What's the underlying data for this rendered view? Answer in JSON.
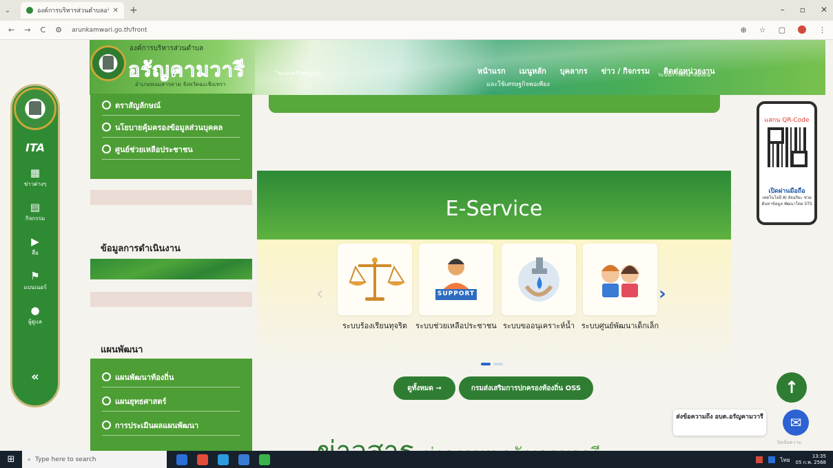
{
  "browser": {
    "tab_title": "องค์การบริหารส่วนตำบลอรัญ...",
    "url": "arunkamwari.go.th/front",
    "new_tab": "+",
    "controls": {
      "back": "←",
      "forward": "→",
      "reload": "C"
    },
    "window_controls": {
      "minimize": "–",
      "maximize": "▫",
      "close": "✕"
    }
  },
  "header": {
    "org_label": "องค์การบริหารส่วนตำบล",
    "site_name": "อรัญคามวารี",
    "tagline": "อำเภอพนมสารคาม จังหวัดฉะเชิงเทรา",
    "marquee": "\"ครอบครัวสมบูรณ์...",
    "nav": [
      "หน้าแรก",
      "เมนูหลัก",
      "บุคลากร",
      "ข่าว / กิจกรรม",
      "ติดต่อหน่วยงาน"
    ],
    "nav_sub": "และใช้เศรษฐกิจพอเพียง",
    "overlap_label": "ระบบการศึกษาท้องถิ่น"
  },
  "sidebar": {
    "ita": "ITA",
    "items": [
      {
        "label": "ข่าวต่างๆ",
        "icon": "news-icon",
        "glyph": "▦"
      },
      {
        "label": "กิจกรรม",
        "icon": "calendar-icon",
        "glyph": "▤"
      },
      {
        "label": "สื่อ",
        "icon": "play-icon",
        "glyph": "▶"
      },
      {
        "label": "แบนเนอร์",
        "icon": "flag-icon",
        "glyph": "⚑"
      },
      {
        "label": "ผู้ดูแล",
        "icon": "user-icon",
        "glyph": "●"
      }
    ],
    "collapse": "«"
  },
  "left_menu": {
    "items": [
      "ตราสัญลักษณ์",
      "นโยบายคุ้มครองข้อมูลส่วนบุคคล",
      "ศูนย์ช่วยเหลือประชาชน"
    ],
    "operations_title": "ข้อมูลการดำเนินงาน",
    "plan_title": "แผนพัฒนา",
    "plan_items": [
      "แผนพัฒนาท้องถิ่น",
      "แผนยุทธศาสตร์",
      "การประเมินผลแผนพัฒนา"
    ]
  },
  "eservice": {
    "title": "E-Service",
    "cards": [
      {
        "label": "ระบบร้องเรียนทุจริต",
        "icon": "scales-icon"
      },
      {
        "label": "ระบบช่วยเหลือประชาชน",
        "icon": "support-icon",
        "badge": "SUPPORT"
      },
      {
        "label": "ระบบขออนุเคราะห์น้ำ",
        "icon": "water-tap-icon"
      },
      {
        "label": "ระบบศูนย์พัฒนาเด็กเล็ก",
        "icon": "children-icon"
      }
    ],
    "view_all": "ดูทั้งหมด →",
    "oss": "กรมส่งเสริมการปกครองท้องถิ่น OSS"
  },
  "news": {
    "title_big": "ข่าวสาร",
    "title_small": "ข่าวงานฯ อรัญคามวารี"
  },
  "qr_card": {
    "head": "แสกน QR-Code",
    "line1": "เปิดผ่านมือถือ",
    "line2": "เทคโนโลยี AI อัจฉริยะ ช่วยค้นหาข้อมูล พัฒนาโดย STS"
  },
  "chat": {
    "bubble": "ส่งข้อความถึง อบต.อรัญคามวารี",
    "caption": "ปิดข้อความ"
  },
  "taskbar": {
    "search_placeholder": "Type here to search",
    "time": "13:35",
    "date": "05 ก.พ. 2568",
    "lang": "ไทย"
  },
  "colors": {
    "primary_green": "#2f7d32",
    "light_green": "#4d9e34",
    "accent_blue": "#2a67c8",
    "logo_blue": "#1e56a8"
  }
}
